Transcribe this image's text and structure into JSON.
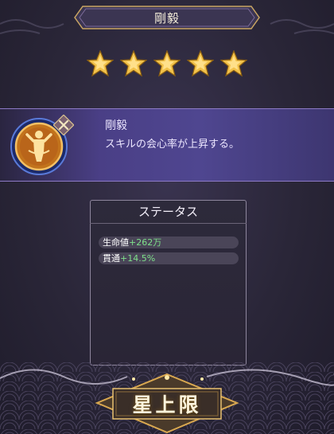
{
  "header": {
    "title": "剛毅"
  },
  "stars": {
    "count": 5,
    "filled": 5,
    "color": "#f2c24a"
  },
  "skill": {
    "name": "剛毅",
    "description": "スキルの会心率が上昇する。",
    "icon": "figure-medal-icon",
    "badge_icon": "crossed-weapons-icon"
  },
  "status": {
    "title": "ステータス",
    "rows": [
      {
        "label": "生命値",
        "value": "+262万"
      },
      {
        "label": "貫通",
        "value": "+14.5%"
      }
    ]
  },
  "bottom_button": {
    "label": "星上限"
  },
  "colors": {
    "accent_gold": "#e8b64c",
    "stat_green": "#7ee08a",
    "panel_purple": "#4a3f86"
  }
}
